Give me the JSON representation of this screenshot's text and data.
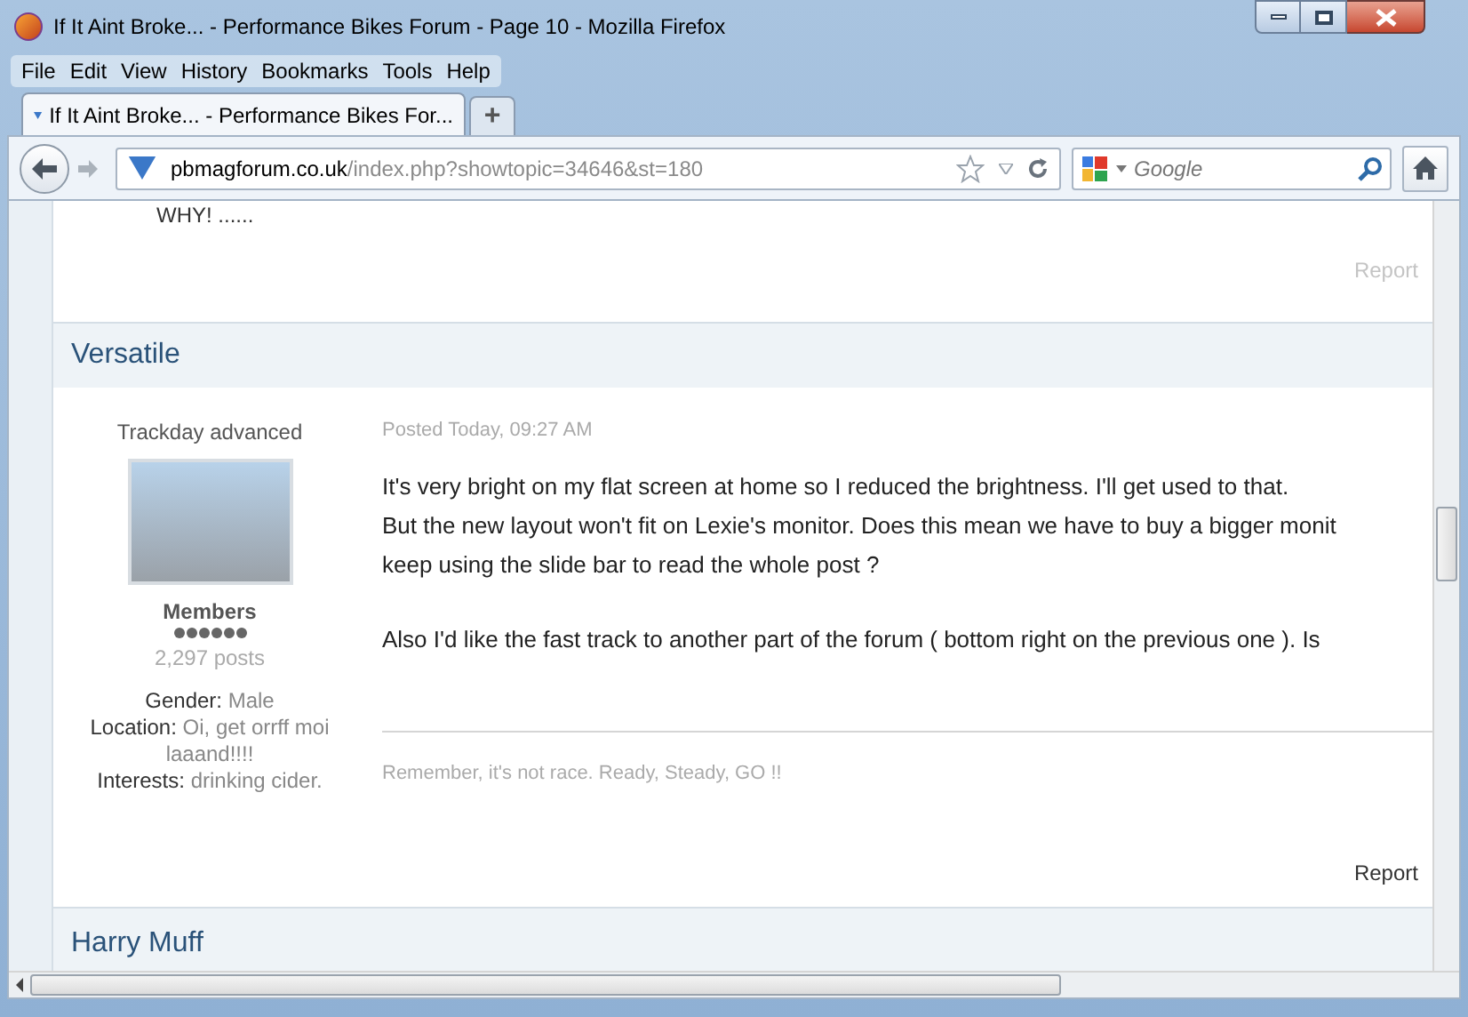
{
  "window": {
    "title": "If It Aint Broke... - Performance Bikes Forum - Page 10 - Mozilla Firefox"
  },
  "menu": [
    "File",
    "Edit",
    "View",
    "History",
    "Bookmarks",
    "Tools",
    "Help"
  ],
  "tabs": [
    {
      "label": "If It Aint Broke... - Performance Bikes For...",
      "selected": true
    }
  ],
  "new_tab": "+",
  "address": {
    "domain": "pbmagforum.co.uk",
    "path": "/index.php?showtopic=34646&st=180"
  },
  "search": {
    "placeholder": "Google"
  },
  "previous_post": {
    "text": "WHY! ......",
    "report": "Report"
  },
  "post": {
    "author": "Versatile",
    "rank_title": "Trackday advanced",
    "group": "Members",
    "stars": 6,
    "post_count": "2,297 posts",
    "fields": [
      {
        "label": "Gender:",
        "value": "Male"
      },
      {
        "label": "Location:",
        "value": "Oi, get orrff moi laaand!!!!"
      },
      {
        "label": "Interests:",
        "value": "drinking cider."
      }
    ],
    "posted": "Posted Today, 09:27 AM",
    "paragraphs": [
      [
        "It's very bright on my flat screen at home so I reduced the brightness. I'll get used to that.",
        "But the new layout won't fit on Lexie's monitor. Does this mean we have to buy a bigger monit",
        "keep using the slide bar to read the whole post ?"
      ],
      [
        "Also I'd like the fast track to another part of the forum ( bottom right on the previous one ). Is"
      ]
    ],
    "signature": "Remember, it's not race. Ready, Steady, GO !!",
    "report": "Report"
  },
  "next_post": {
    "author": "Harry Muff"
  }
}
